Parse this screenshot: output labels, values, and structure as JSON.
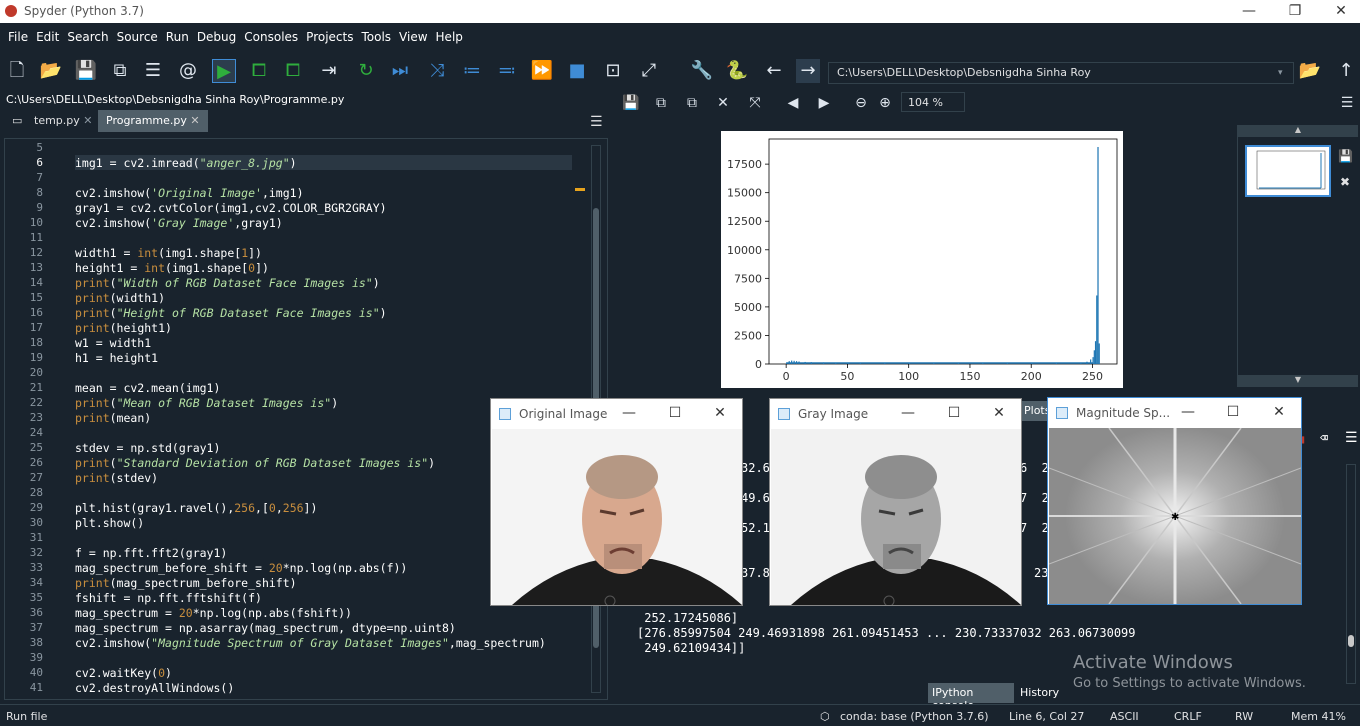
{
  "window": {
    "title": "Spyder (Python 3.7)",
    "min": "—",
    "max": "❐",
    "close": "✕"
  },
  "menu": [
    "File",
    "Edit",
    "Search",
    "Source",
    "Run",
    "Debug",
    "Consoles",
    "Projects",
    "Tools",
    "View",
    "Help"
  ],
  "toolbar": {
    "path": "C:\\Users\\DELL\\Desktop\\Debsnigdha Sinha Roy"
  },
  "editor": {
    "file_path": "C:\\Users\\DELL\\Desktop\\Debsnigdha Sinha Roy\\Programme.py",
    "tabs": [
      {
        "label": "temp.py"
      },
      {
        "label": "Programme.py"
      }
    ],
    "lines": [
      {
        "n": "5",
        "t": ""
      },
      {
        "n": "6",
        "t": "img1 = cv2.imread(\"anger_8.jpg\")"
      },
      {
        "n": "7",
        "t": ""
      },
      {
        "n": "8",
        "t": "cv2.imshow('Original Image',img1)"
      },
      {
        "n": "9",
        "t": "gray1 = cv2.cvtColor(img1,cv2.COLOR_BGR2GRAY)"
      },
      {
        "n": "10",
        "t": "cv2.imshow('Gray Image',gray1)"
      },
      {
        "n": "11",
        "t": ""
      },
      {
        "n": "12",
        "t": "width1 = int(img1.shape[1])"
      },
      {
        "n": "13",
        "t": "height1 = int(img1.shape[0])"
      },
      {
        "n": "14",
        "t": "print(\"Width of RGB Dataset Face Images is\")"
      },
      {
        "n": "15",
        "t": "print(width1)"
      },
      {
        "n": "16",
        "t": "print(\"Height of RGB Dataset Face Images is\")"
      },
      {
        "n": "17",
        "t": "print(height1)"
      },
      {
        "n": "18",
        "t": "w1 = width1"
      },
      {
        "n": "19",
        "t": "h1 = height1"
      },
      {
        "n": "20",
        "t": ""
      },
      {
        "n": "21",
        "t": "mean = cv2.mean(img1)"
      },
      {
        "n": "22",
        "t": "print(\"Mean of RGB Dataset Images is\")"
      },
      {
        "n": "23",
        "t": "print(mean)"
      },
      {
        "n": "24",
        "t": ""
      },
      {
        "n": "25",
        "t": "stdev = np.std(gray1)"
      },
      {
        "n": "26",
        "t": "print(\"Standard Deviation of RGB Dataset Images is\")"
      },
      {
        "n": "27",
        "t": "print(stdev)"
      },
      {
        "n": "28",
        "t": ""
      },
      {
        "n": "29",
        "t": "plt.hist(gray1.ravel(),256,[0,256])"
      },
      {
        "n": "30",
        "t": "plt.show()"
      },
      {
        "n": "31",
        "t": ""
      },
      {
        "n": "32",
        "t": "f = np.fft.fft2(gray1)"
      },
      {
        "n": "33",
        "t": "mag_spectrum_before_shift = 20*np.log(np.abs(f))"
      },
      {
        "n": "34",
        "t": "print(mag_spectrum_before_shift)"
      },
      {
        "n": "35",
        "t": "fshift = np.fft.fftshift(f)"
      },
      {
        "n": "36",
        "t": "mag_spectrum = 20*np.log(np.abs(fshift))"
      },
      {
        "n": "37",
        "t": "mag_spectrum = np.asarray(mag_spectrum, dtype=np.uint8)"
      },
      {
        "n": "38",
        "t": "cv2.imshow(\"Magnitude Spectrum of Gray Dataset Images\",mag_spectrum)"
      },
      {
        "n": "39",
        "t": ""
      },
      {
        "n": "40",
        "t": "cv2.waitKey(0)"
      },
      {
        "n": "41",
        "t": "cv2.destroyAllWindows()"
      }
    ]
  },
  "plots": {
    "zoom": "104 %",
    "label": "Plots",
    "chart_data": {
      "type": "bar",
      "title": "",
      "xlabel": "",
      "ylabel": "",
      "xlim": [
        -14,
        270
      ],
      "ylim": [
        0,
        19700
      ],
      "xticks": [
        "0",
        "50",
        "100",
        "150",
        "200",
        "250"
      ],
      "yticks": [
        "0",
        "2500",
        "5000",
        "7500",
        "10000",
        "12500",
        "15000",
        "17500"
      ],
      "color": "#1f77b4",
      "x": [
        0,
        2,
        4,
        6,
        8,
        10,
        15,
        20,
        30,
        40,
        50,
        60,
        80,
        100,
        120,
        140,
        160,
        180,
        200,
        220,
        240,
        245,
        248,
        250,
        251,
        252,
        253,
        254,
        255
      ],
      "values": [
        100,
        250,
        300,
        280,
        250,
        220,
        180,
        160,
        140,
        120,
        110,
        100,
        90,
        80,
        80,
        70,
        70,
        70,
        70,
        80,
        120,
        200,
        400,
        600,
        1200,
        2000,
        6000,
        19000,
        1800
      ]
    }
  },
  "console": {
    "lines": [
      "32.6",
      "49.6",
      "52.1",
      "37.8",
      "[276.85997504 249.46931898 261.09451453 ... 230.73337032 263.06730099",
      " 249.62109434]]",
      " 252.17245086]"
    ],
    "right_fragments": [
      "6  25",
      "7  26",
      "7  26",
      "23"
    ],
    "tabs": [
      "IPython console",
      "History"
    ]
  },
  "windows": {
    "original": {
      "title": "Original Image"
    },
    "gray": {
      "title": "Gray Image"
    },
    "magnitude": {
      "title": "Magnitude Sp..."
    }
  },
  "activate": {
    "title": "Activate Windows",
    "sub": "Go to Settings to activate Windows."
  },
  "status": {
    "left": "Run file",
    "env": "conda: base (Python 3.7.6)",
    "position": "Line 6, Col 27",
    "encoding": "ASCII",
    "eol": "CRLF",
    "perm": "RW",
    "mem": "Mem 41%"
  }
}
